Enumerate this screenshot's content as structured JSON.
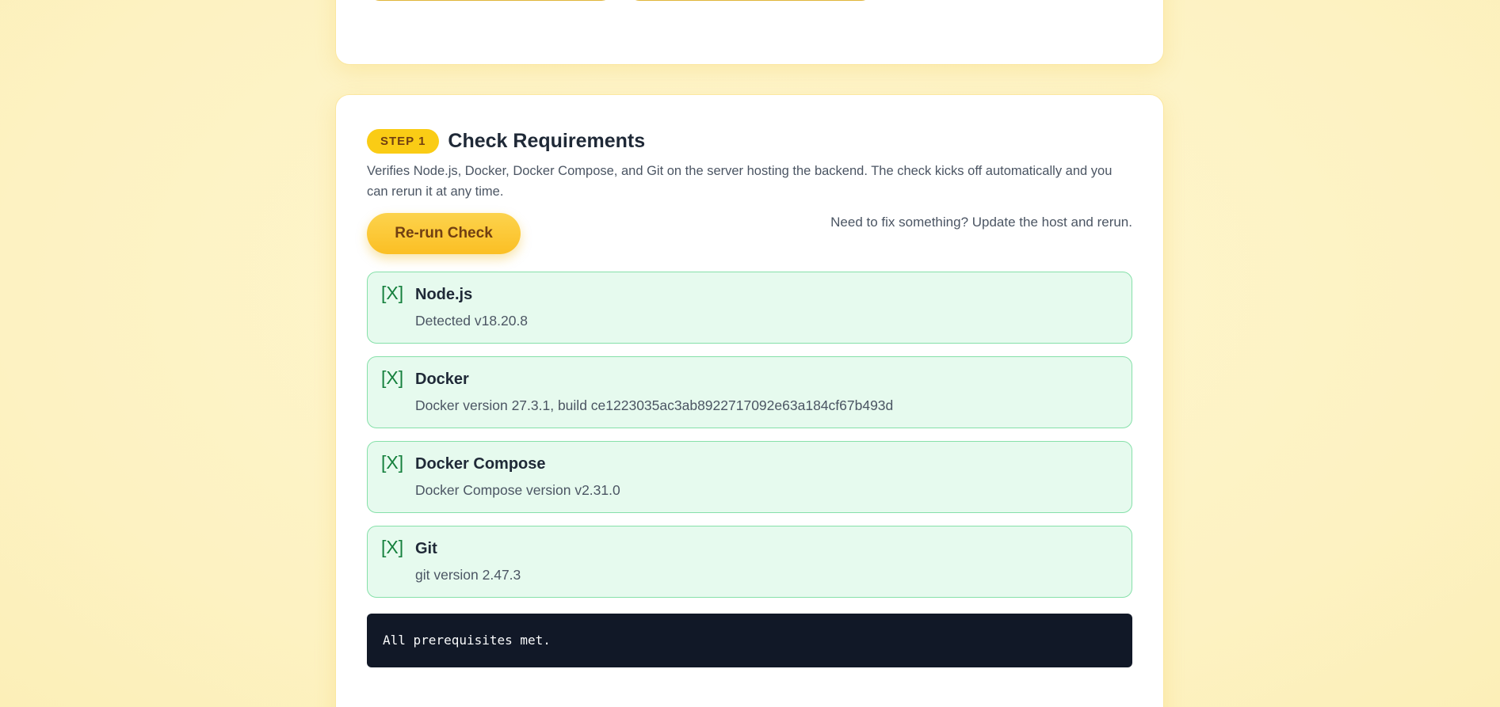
{
  "step": {
    "badge": "STEP 1",
    "title": "Check Requirements",
    "description": "Verifies Node.js, Docker, Docker Compose, and Git on the server hosting the backend. The check kicks off automatically and you can rerun it at any time."
  },
  "actions": {
    "rerun_label": "Re-run Check",
    "hint": "Need to fix something? Update the host and rerun."
  },
  "requirements": [
    {
      "status": "[X]",
      "name": "Node.js",
      "detail": "Detected v18.20.8"
    },
    {
      "status": "[X]",
      "name": "Docker",
      "detail": "Docker version 27.3.1, build ce1223035ac3ab8922717092e63a184cf67b493d"
    },
    {
      "status": "[X]",
      "name": "Docker Compose",
      "detail": "Docker Compose version v2.31.0"
    },
    {
      "status": "[X]",
      "name": "Git",
      "detail": "git version 2.47.3"
    }
  ],
  "console": {
    "output": "All prerequisites met."
  },
  "colors": {
    "accent": "#facc15",
    "success_bg": "#e6faee",
    "success_border": "#86e0a9",
    "console_bg": "#111827"
  }
}
